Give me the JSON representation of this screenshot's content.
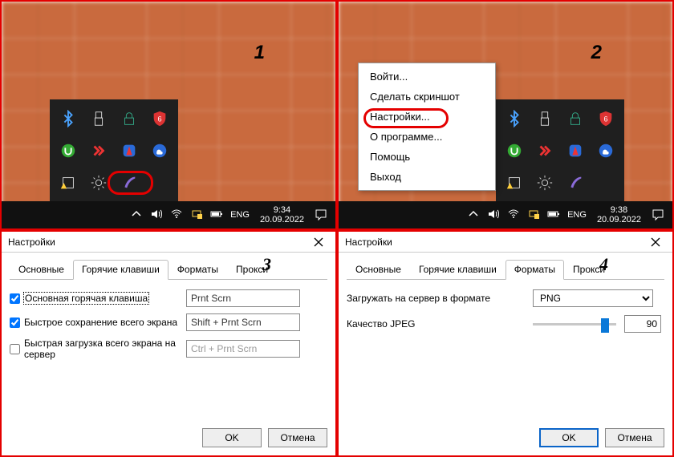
{
  "labels": {
    "1": "1",
    "2": "2",
    "3": "3",
    "4": "4"
  },
  "tray_icons": [
    "bluetooth-icon",
    "usb-icon",
    "lock-icon",
    "shield-badge-icon",
    "utorrent-icon",
    "anydesk-icon",
    "browser-icon",
    "cloud-icon",
    "warning-icon",
    "gear-icon",
    "feather-icon",
    ""
  ],
  "taskbar": {
    "lang": "ENG",
    "p1": {
      "time": "9:34",
      "date": "20.09.2022"
    },
    "p2": {
      "time": "9:38",
      "date": "20.09.2022"
    }
  },
  "context_menu": {
    "items": [
      "Войти...",
      "Сделать скриншот",
      "Настройки...",
      "О программе...",
      "Помощь",
      "Выход"
    ],
    "highlight_index": 2
  },
  "dialog": {
    "title": "Настройки",
    "tabs": [
      "Основные",
      "Горячие клавиши",
      "Форматы",
      "Прокси"
    ],
    "ok": "OK",
    "cancel": "Отмена"
  },
  "panel3": {
    "active_tab_index": 1,
    "rows": [
      {
        "label": "Основная горячая клавиша",
        "checked": true,
        "value": "Prnt Scrn",
        "disabled": false,
        "dashed": true
      },
      {
        "label": "Быстрое сохранение всего экрана",
        "checked": true,
        "value": "Shift + Prnt Scrn",
        "disabled": false,
        "dashed": false
      },
      {
        "label": "Быстрая загрузка всего экрана на сервер",
        "checked": false,
        "value": "Ctrl + Prnt Scrn",
        "disabled": true,
        "dashed": false
      }
    ]
  },
  "panel4": {
    "active_tab_index": 2,
    "upload_label": "Загружать на сервер в формате",
    "upload_value": "PNG",
    "quality_label": "Качество JPEG",
    "quality_value": "90",
    "quality_percent": 90
  }
}
